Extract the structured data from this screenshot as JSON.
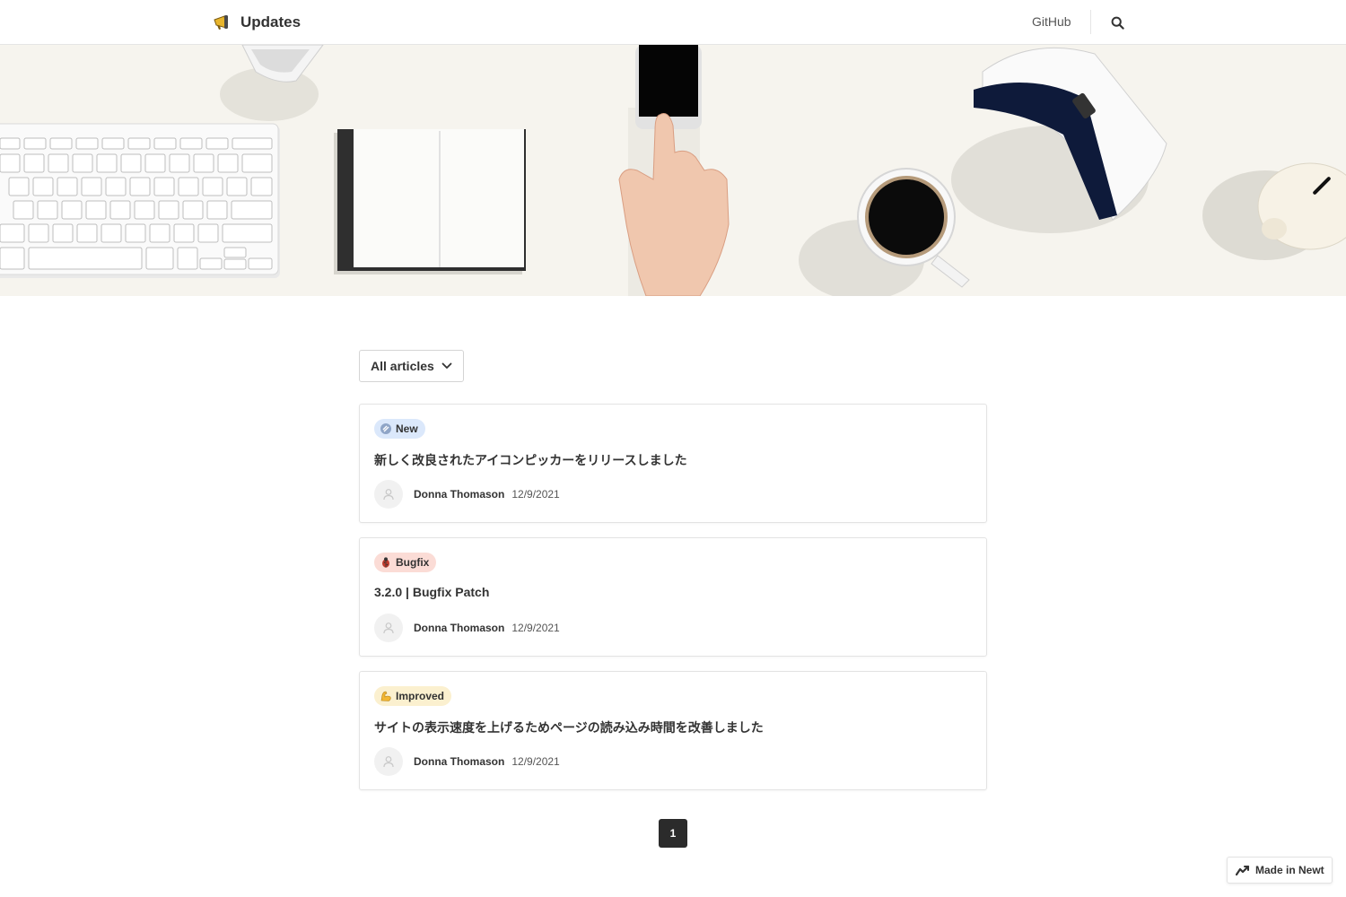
{
  "header": {
    "brand_name": "Updates",
    "brand_icon": "megaphone-icon",
    "nav_link": "GitHub",
    "search_icon": "search-icon"
  },
  "filter": {
    "label": "All articles",
    "icon": "chevron-down-icon"
  },
  "articles": [
    {
      "tag": "New",
      "tag_icon": "sparkle-icon",
      "tag_color": "#dbe8fb",
      "title": "新しく改良されたアイコンピッカーをリリースしました",
      "author": "Donna Thomason",
      "date": "12/9/2021"
    },
    {
      "tag": "Bugfix",
      "tag_icon": "bug-icon",
      "tag_color": "#fbdcd6",
      "title": "3.2.0 | Bugfix Patch",
      "author": "Donna Thomason",
      "date": "12/9/2021"
    },
    {
      "tag": "Improved",
      "tag_icon": "flexed-biceps-icon",
      "tag_color": "#fbf0cf",
      "title": "サイトの表示速度を上げるためページの読み込み時間を改善しました",
      "author": "Donna Thomason",
      "date": "12/9/2021"
    }
  ],
  "pagination": {
    "current_page": "1"
  },
  "badge": {
    "label": "Made in Newt",
    "icon": "newt-logo-icon"
  },
  "colors": {
    "text": "#333333",
    "border": "#e3e3e3",
    "hero_background": "#f6f4ee",
    "page_active": "#2b2b2b"
  }
}
